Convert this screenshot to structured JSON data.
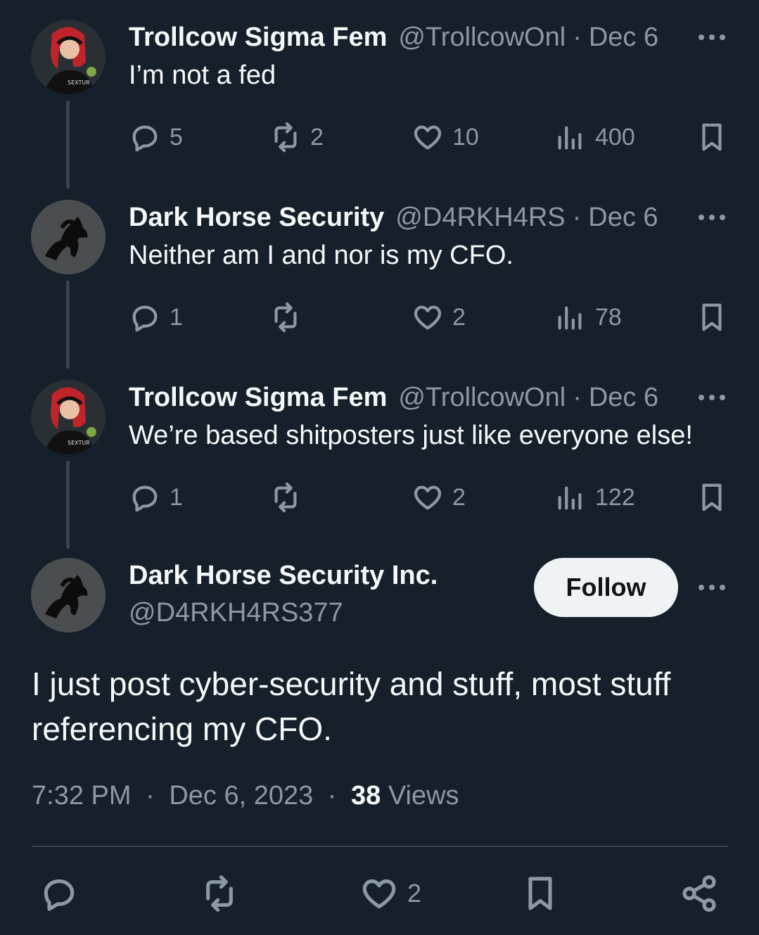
{
  "thread": [
    {
      "name": "Trollcow Sigma Fem",
      "handle": "@TrollcowOnl",
      "date": "Dec 6",
      "text": "I’m not a fed",
      "replies": "5",
      "reposts": "2",
      "likes": "10",
      "views": "400",
      "avatar": "avatar-red-hair"
    },
    {
      "name": "Dark Horse Security",
      "handle": "@D4RKH4RS",
      "date": "Dec 6",
      "text": "Neither am I and nor is my CFO.",
      "replies": "1",
      "reposts": "",
      "likes": "2",
      "views": "78",
      "avatar": "avatar-dark-horse"
    },
    {
      "name": "Trollcow Sigma Fem",
      "handle": "@TrollcowOnl",
      "date": "Dec 6",
      "text": "We’re based shitposters just like everyone else!",
      "replies": "1",
      "reposts": "",
      "likes": "2",
      "views": "122",
      "avatar": "avatar-red-hair"
    }
  ],
  "separator": "·",
  "main": {
    "name": "Dark Horse Security Inc.",
    "handle": "@D4RKH4RS377",
    "follow_label": "Follow",
    "text": "I just post cyber-security and stuff, most stuff referencing my CFO.",
    "time": "7:32 PM",
    "date": "Dec 6, 2023",
    "views_count": "38",
    "views_label": "Views",
    "likes": "2"
  },
  "colors": {
    "background": "#15202b",
    "muted": "#8b98a5",
    "text": "#f7f9f9",
    "divider": "#38444d",
    "follow_bg": "#eff3f4"
  }
}
